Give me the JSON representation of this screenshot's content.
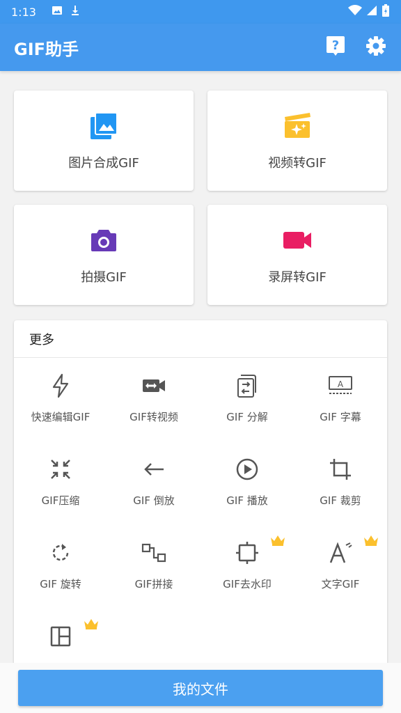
{
  "status_bar": {
    "time": "1:13",
    "left_icons": [
      "image-icon",
      "download-icon"
    ],
    "right_icons": [
      "wifi-icon",
      "signal-icon",
      "battery-icon"
    ]
  },
  "app_bar": {
    "title": "GIF助手",
    "actions": [
      "help-icon",
      "gear-icon"
    ],
    "color": "#4599ee"
  },
  "main_cards": [
    {
      "label": "图片合成GIF",
      "icon": "photo-library-icon",
      "color": "#2196f3"
    },
    {
      "label": "视频转GIF",
      "icon": "movie-sparkle-icon",
      "color": "#fbc02d"
    },
    {
      "label": "拍摄GIF",
      "icon": "camera-icon",
      "color": "#673ab7"
    },
    {
      "label": "录屏转GIF",
      "icon": "video-camera-icon",
      "color": "#e91e63"
    }
  ],
  "more": {
    "title": "更多",
    "tools": [
      {
        "label": "快速编辑GIF",
        "icon": "flash-icon",
        "premium": false
      },
      {
        "label": "GIF转视频",
        "icon": "video-convert-icon",
        "premium": false
      },
      {
        "label": "GIF 分解",
        "icon": "split-icon",
        "premium": false
      },
      {
        "label": "GIF 字幕",
        "icon": "subtitle-icon",
        "premium": false
      },
      {
        "label": "GIF压缩",
        "icon": "compress-icon",
        "premium": false
      },
      {
        "label": "GIF 倒放",
        "icon": "arrow-left-icon",
        "premium": false
      },
      {
        "label": "GIF 播放",
        "icon": "play-icon",
        "premium": false
      },
      {
        "label": "GIF 裁剪",
        "icon": "crop-icon",
        "premium": false
      },
      {
        "label": "GIF 旋转",
        "icon": "rotate-icon",
        "premium": false
      },
      {
        "label": "GIF拼接",
        "icon": "join-icon",
        "premium": false
      },
      {
        "label": "GIF去水印",
        "icon": "watermark-remove-icon",
        "premium": true
      },
      {
        "label": "文字GIF",
        "icon": "text-icon",
        "premium": true
      },
      {
        "label": "",
        "icon": "collage-icon",
        "premium": true
      }
    ]
  },
  "bottom_button": {
    "label": "我的文件",
    "color": "#4ba0f0"
  },
  "colors": {
    "crown": "#fbc02d",
    "tool_icon": "#555555"
  }
}
